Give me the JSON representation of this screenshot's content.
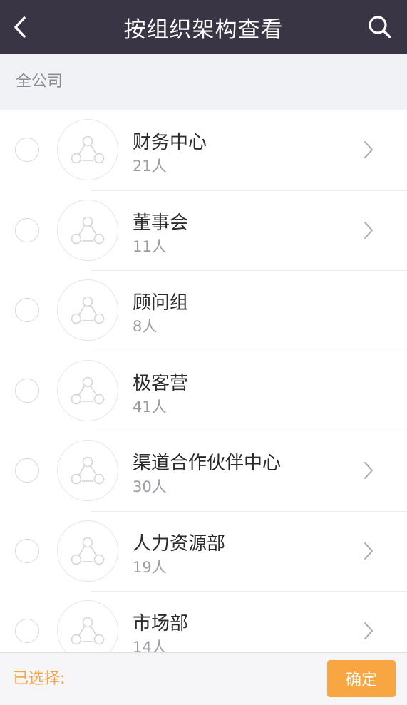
{
  "header": {
    "title": "按组织架构查看",
    "back_icon": "chevron-left-icon",
    "search_icon": "search-icon"
  },
  "breadcrumb": {
    "label": "全公司"
  },
  "departments": [
    {
      "name": "财务中心",
      "count": "21人",
      "has_children": true
    },
    {
      "name": "董事会",
      "count": "11人",
      "has_children": true
    },
    {
      "name": "顾问组",
      "count": "8人",
      "has_children": false
    },
    {
      "name": "极客营",
      "count": "41人",
      "has_children": false
    },
    {
      "name": "渠道合作伙伴中心",
      "count": "30人",
      "has_children": true
    },
    {
      "name": "人力资源部",
      "count": "19人",
      "has_children": true
    },
    {
      "name": "市场部",
      "count": "14人",
      "has_children": true
    }
  ],
  "footer": {
    "selected_label": "已选择:",
    "confirm_label": "确定"
  },
  "colors": {
    "header_bg": "#3a3545",
    "accent": "#f7a641",
    "breadcrumb_bg": "#f1f2f6"
  }
}
